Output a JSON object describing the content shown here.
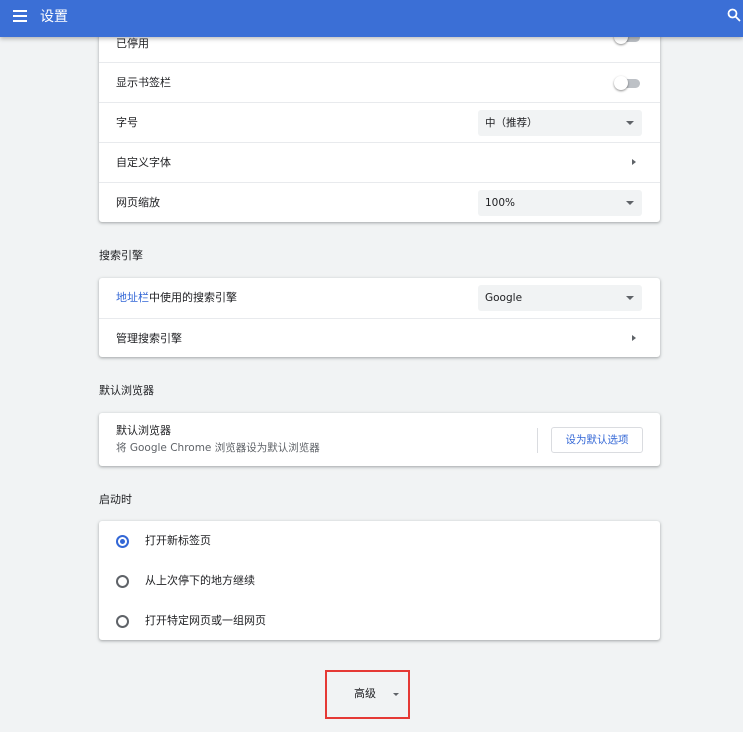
{
  "header": {
    "title": "设置",
    "menu_icon": "menu-icon",
    "search_icon": "search-icon",
    "color": "#3b6fd6"
  },
  "appearance": {
    "hidden_row_label": "已停用",
    "show_bookmarks_bar": {
      "label": "显示书签栏",
      "enabled": false
    },
    "font_size": {
      "label": "字号",
      "value": "中（推荐）"
    },
    "custom_fonts": {
      "label": "自定义字体"
    },
    "page_zoom": {
      "label": "网页缩放",
      "value": "100%"
    }
  },
  "search_engine": {
    "section_title": "搜索引擎",
    "engine_row": {
      "link": "地址栏",
      "label_rest": "中使用的搜索引擎",
      "value": "Google"
    },
    "manage_row": {
      "label": "管理搜索引擎"
    }
  },
  "default_browser": {
    "section_title": "默认浏览器",
    "title": "默认浏览器",
    "subtitle": "将 Google Chrome 浏览器设为默认浏览器",
    "button_label": "设为默认选项"
  },
  "on_startup": {
    "section_title": "启动时",
    "options": [
      {
        "label": "打开新标签页",
        "checked": true
      },
      {
        "label": "从上次停下的地方继续",
        "checked": false
      },
      {
        "label": "打开特定网页或一组网页",
        "checked": false
      }
    ]
  },
  "advanced": {
    "label": "高级"
  },
  "colors": {
    "accent": "#3367d6",
    "highlight_border": "#e53935"
  }
}
